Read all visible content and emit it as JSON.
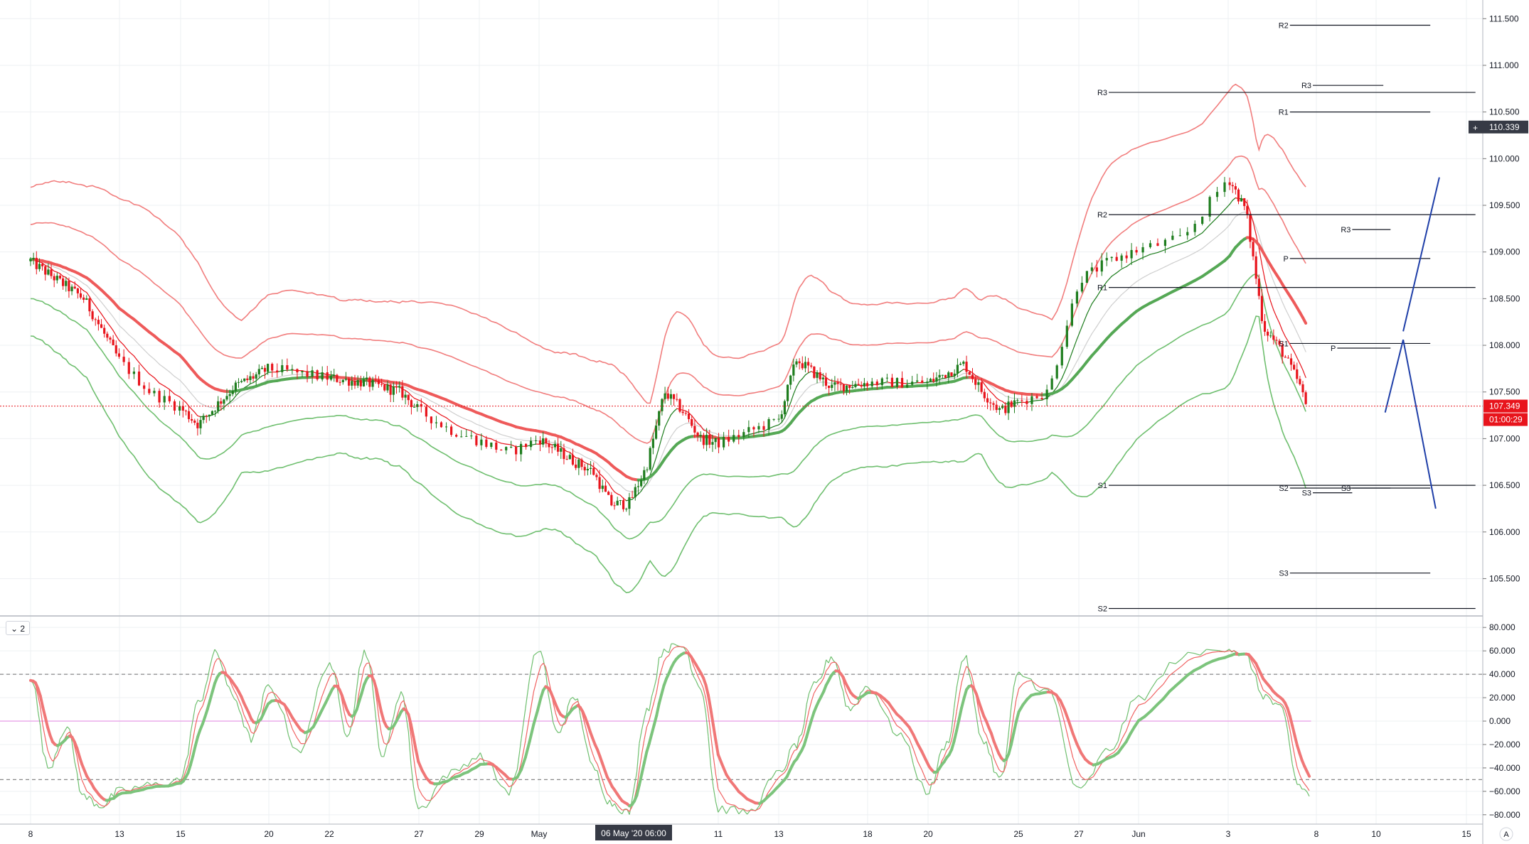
{
  "osc_badge": {
    "chevron": "⌄",
    "label": "2"
  },
  "cursor_time": "06 May '20   06:00",
  "axis_scale_btn": "A",
  "price_tags": {
    "last_price": "107.349",
    "countdown": "01:00:29",
    "crosshair_price": "110.339"
  },
  "colors": {
    "up": "#1e7d1e",
    "down": "#e8141c",
    "upper_band": "#f17d7d",
    "lower_band": "#6fbf6f",
    "projection": "#1f3fa8",
    "grid": "#eef0f3"
  },
  "chart_data": {
    "type": "candlestick",
    "symbol_hint": "USDJPY H4",
    "main_panel": {
      "ylim": [
        105.1,
        111.7
      ],
      "yticks": [
        "111.500",
        "111.000",
        "110.500",
        "110.000",
        "109.500",
        "109.000",
        "108.500",
        "108.000",
        "107.500",
        "107.000",
        "106.500",
        "106.000",
        "105.500"
      ],
      "last_price": 107.349,
      "crosshair_price": 110.339,
      "series_description": [
        "candles",
        "red/green slow MA",
        "thin red/green fast MA",
        "grey MA",
        "upper envelope bands (red)",
        "lower envelope bands (green)"
      ]
    },
    "x_axis": {
      "labels": [
        "8",
        "13",
        "15",
        "20",
        "22",
        "27",
        "29",
        "May",
        "11",
        "13",
        "18",
        "20",
        "25",
        "27",
        "Jun",
        "3",
        "8",
        "10",
        "15"
      ]
    },
    "anchors_day_index": [
      0,
      5,
      7,
      12,
      14,
      19,
      21,
      23,
      33,
      35,
      40,
      42,
      47,
      49,
      51,
      53,
      58,
      60,
      65
    ],
    "price_path": [
      [
        0,
        108.9
      ],
      [
        3,
        108.5
      ],
      [
        6,
        107.5
      ],
      [
        8,
        107.15
      ],
      [
        10,
        107.55
      ],
      [
        12,
        107.75
      ],
      [
        14,
        107.65
      ],
      [
        16,
        107.6
      ],
      [
        18,
        107.5
      ],
      [
        20,
        107.1
      ],
      [
        22,
        106.85
      ],
      [
        23,
        107.0
      ],
      [
        25,
        106.75
      ],
      [
        26,
        106.65
      ],
      [
        27,
        106.3
      ],
      [
        28,
        106.3
      ],
      [
        29,
        106.7
      ],
      [
        30,
        107.5
      ],
      [
        31,
        107.3
      ],
      [
        32,
        107.0
      ],
      [
        33,
        106.95
      ],
      [
        35,
        107.2
      ],
      [
        36,
        107.85
      ],
      [
        38,
        107.55
      ],
      [
        40,
        107.6
      ],
      [
        42,
        107.6
      ],
      [
        44,
        107.8
      ],
      [
        45,
        107.5
      ],
      [
        46,
        107.3
      ],
      [
        48,
        107.5
      ],
      [
        49,
        108.7
      ],
      [
        50,
        108.9
      ],
      [
        52,
        109.15
      ],
      [
        53,
        109.8
      ],
      [
        54,
        109.45
      ],
      [
        55,
        108.2
      ],
      [
        56,
        107.95
      ],
      [
        57,
        107.6
      ],
      [
        57.4,
        107.35
      ]
    ],
    "pivot_lines": [
      {
        "label": "R2",
        "price": 111.43,
        "from": 56.5,
        "to": 63.0
      },
      {
        "label": "R3",
        "price": 110.785,
        "from": 57.8,
        "to": 60.4
      },
      {
        "label": "R3",
        "price": 110.71,
        "from": 50.0,
        "to": 65.5
      },
      {
        "label": "R1",
        "price": 110.5,
        "from": 56.5,
        "to": 63.0
      },
      {
        "label": "R2",
        "price": 109.4,
        "from": 50.0,
        "to": 65.5
      },
      {
        "label": "R3",
        "price": 109.24,
        "from": 59.2,
        "to": 60.8
      },
      {
        "label": "P",
        "price": 108.93,
        "from": 56.5,
        "to": 63.0
      },
      {
        "label": "R1",
        "price": 108.62,
        "from": 50.0,
        "to": 65.5
      },
      {
        "label": "S1",
        "price": 108.02,
        "from": 56.5,
        "to": 63.0
      },
      {
        "label": "P",
        "price": 107.97,
        "from": 58.7,
        "to": 60.8
      },
      {
        "label": "S1",
        "price": 106.5,
        "from": 50.0,
        "to": 65.5
      },
      {
        "label": "S2",
        "price": 106.47,
        "from": 56.5,
        "to": 63.0
      },
      {
        "label": "S3",
        "price": 106.47,
        "from": 59.2,
        "to": 60.8
      },
      {
        "label": "S3",
        "price": 106.42,
        "from": 57.8,
        "to": 59.2
      },
      {
        "label": "S3",
        "price": 105.56,
        "from": 56.5,
        "to": 63.0
      },
      {
        "label": "S2",
        "price": 105.18,
        "from": 50.0,
        "to": 65.5
      }
    ],
    "projection_lines": [
      {
        "from": [
          60.5,
          107.28
        ],
        "to": [
          61.5,
          108.06
        ]
      },
      {
        "from": [
          61.5,
          108.06
        ],
        "to": [
          63.3,
          106.25
        ]
      },
      {
        "from": [
          61.5,
          108.15
        ],
        "to": [
          63.5,
          109.8
        ]
      }
    ],
    "oscillator": {
      "ylim": [
        -88,
        88
      ],
      "yticks": [
        "80.000",
        "60.000",
        "40.000",
        "20.000",
        "0.000",
        "−20.000",
        "−40.000",
        "−60.000",
        "−80.000"
      ],
      "levels": [
        40,
        -50
      ],
      "midline": 0,
      "path": [
        [
          0,
          38
        ],
        [
          1,
          -40
        ],
        [
          2,
          -5
        ],
        [
          3,
          -65
        ],
        [
          4,
          -72
        ],
        [
          5,
          -60
        ],
        [
          6,
          -55
        ],
        [
          7,
          -50
        ],
        [
          8,
          15
        ],
        [
          9,
          58
        ],
        [
          10,
          20
        ],
        [
          11,
          -15
        ],
        [
          12,
          30
        ],
        [
          13,
          -25
        ],
        [
          14,
          50
        ],
        [
          15,
          -10
        ],
        [
          16,
          60
        ],
        [
          17,
          -30
        ],
        [
          18,
          25
        ],
        [
          19,
          -75
        ],
        [
          20,
          -45
        ],
        [
          21,
          -30
        ],
        [
          22,
          -60
        ],
        [
          23,
          62
        ],
        [
          24,
          -10
        ],
        [
          25,
          20
        ],
        [
          26,
          -40
        ],
        [
          27,
          -70
        ],
        [
          28,
          -78
        ],
        [
          29,
          10
        ],
        [
          30,
          62
        ],
        [
          31,
          64
        ],
        [
          32,
          30
        ],
        [
          33,
          -75
        ],
        [
          34,
          -78
        ],
        [
          35,
          -45
        ],
        [
          36,
          -20
        ],
        [
          37,
          30
        ],
        [
          38,
          55
        ],
        [
          39,
          10
        ],
        [
          40,
          30
        ],
        [
          41,
          -10
        ],
        [
          42,
          -60
        ],
        [
          43,
          -20
        ],
        [
          44,
          55
        ],
        [
          45,
          -15
        ],
        [
          46,
          -50
        ],
        [
          47,
          40
        ],
        [
          48,
          25
        ],
        [
          49,
          -60
        ],
        [
          50,
          -25
        ],
        [
          51,
          20
        ],
        [
          52,
          55
        ],
        [
          53,
          63
        ],
        [
          54,
          55
        ],
        [
          55,
          22
        ],
        [
          56,
          10
        ],
        [
          57,
          -55
        ],
        [
          58,
          -70
        ],
        [
          59,
          -78
        ],
        [
          60,
          -80
        ]
      ]
    }
  }
}
